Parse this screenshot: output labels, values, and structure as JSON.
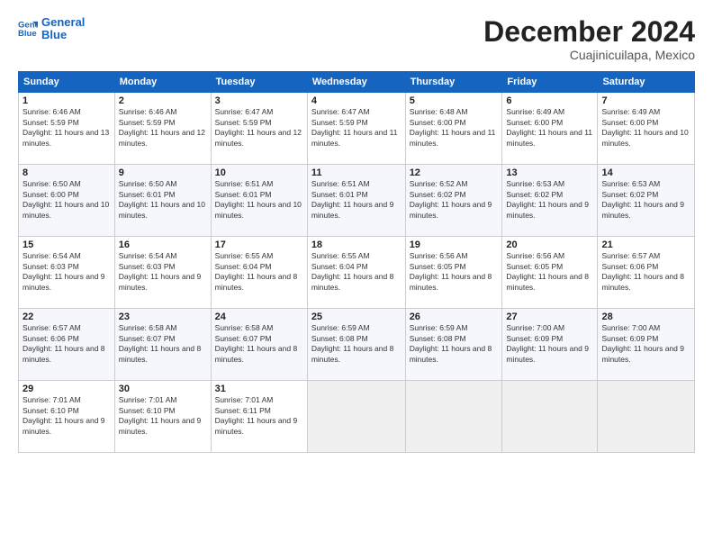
{
  "logo": {
    "line1": "General",
    "line2": "Blue"
  },
  "title": "December 2024",
  "location": "Cuajinicuilapa, Mexico",
  "weekdays": [
    "Sunday",
    "Monday",
    "Tuesday",
    "Wednesday",
    "Thursday",
    "Friday",
    "Saturday"
  ],
  "weeks": [
    [
      {
        "day": "1",
        "sunrise": "6:46 AM",
        "sunset": "5:59 PM",
        "daylight": "11 hours and 13 minutes."
      },
      {
        "day": "2",
        "sunrise": "6:46 AM",
        "sunset": "5:59 PM",
        "daylight": "11 hours and 12 minutes."
      },
      {
        "day": "3",
        "sunrise": "6:47 AM",
        "sunset": "5:59 PM",
        "daylight": "11 hours and 12 minutes."
      },
      {
        "day": "4",
        "sunrise": "6:47 AM",
        "sunset": "5:59 PM",
        "daylight": "11 hours and 11 minutes."
      },
      {
        "day": "5",
        "sunrise": "6:48 AM",
        "sunset": "6:00 PM",
        "daylight": "11 hours and 11 minutes."
      },
      {
        "day": "6",
        "sunrise": "6:49 AM",
        "sunset": "6:00 PM",
        "daylight": "11 hours and 11 minutes."
      },
      {
        "day": "7",
        "sunrise": "6:49 AM",
        "sunset": "6:00 PM",
        "daylight": "11 hours and 10 minutes."
      }
    ],
    [
      {
        "day": "8",
        "sunrise": "6:50 AM",
        "sunset": "6:00 PM",
        "daylight": "11 hours and 10 minutes."
      },
      {
        "day": "9",
        "sunrise": "6:50 AM",
        "sunset": "6:01 PM",
        "daylight": "11 hours and 10 minutes."
      },
      {
        "day": "10",
        "sunrise": "6:51 AM",
        "sunset": "6:01 PM",
        "daylight": "11 hours and 10 minutes."
      },
      {
        "day": "11",
        "sunrise": "6:51 AM",
        "sunset": "6:01 PM",
        "daylight": "11 hours and 9 minutes."
      },
      {
        "day": "12",
        "sunrise": "6:52 AM",
        "sunset": "6:02 PM",
        "daylight": "11 hours and 9 minutes."
      },
      {
        "day": "13",
        "sunrise": "6:53 AM",
        "sunset": "6:02 PM",
        "daylight": "11 hours and 9 minutes."
      },
      {
        "day": "14",
        "sunrise": "6:53 AM",
        "sunset": "6:02 PM",
        "daylight": "11 hours and 9 minutes."
      }
    ],
    [
      {
        "day": "15",
        "sunrise": "6:54 AM",
        "sunset": "6:03 PM",
        "daylight": "11 hours and 9 minutes."
      },
      {
        "day": "16",
        "sunrise": "6:54 AM",
        "sunset": "6:03 PM",
        "daylight": "11 hours and 9 minutes."
      },
      {
        "day": "17",
        "sunrise": "6:55 AM",
        "sunset": "6:04 PM",
        "daylight": "11 hours and 8 minutes."
      },
      {
        "day": "18",
        "sunrise": "6:55 AM",
        "sunset": "6:04 PM",
        "daylight": "11 hours and 8 minutes."
      },
      {
        "day": "19",
        "sunrise": "6:56 AM",
        "sunset": "6:05 PM",
        "daylight": "11 hours and 8 minutes."
      },
      {
        "day": "20",
        "sunrise": "6:56 AM",
        "sunset": "6:05 PM",
        "daylight": "11 hours and 8 minutes."
      },
      {
        "day": "21",
        "sunrise": "6:57 AM",
        "sunset": "6:06 PM",
        "daylight": "11 hours and 8 minutes."
      }
    ],
    [
      {
        "day": "22",
        "sunrise": "6:57 AM",
        "sunset": "6:06 PM",
        "daylight": "11 hours and 8 minutes."
      },
      {
        "day": "23",
        "sunrise": "6:58 AM",
        "sunset": "6:07 PM",
        "daylight": "11 hours and 8 minutes."
      },
      {
        "day": "24",
        "sunrise": "6:58 AM",
        "sunset": "6:07 PM",
        "daylight": "11 hours and 8 minutes."
      },
      {
        "day": "25",
        "sunrise": "6:59 AM",
        "sunset": "6:08 PM",
        "daylight": "11 hours and 8 minutes."
      },
      {
        "day": "26",
        "sunrise": "6:59 AM",
        "sunset": "6:08 PM",
        "daylight": "11 hours and 8 minutes."
      },
      {
        "day": "27",
        "sunrise": "7:00 AM",
        "sunset": "6:09 PM",
        "daylight": "11 hours and 9 minutes."
      },
      {
        "day": "28",
        "sunrise": "7:00 AM",
        "sunset": "6:09 PM",
        "daylight": "11 hours and 9 minutes."
      }
    ],
    [
      {
        "day": "29",
        "sunrise": "7:01 AM",
        "sunset": "6:10 PM",
        "daylight": "11 hours and 9 minutes."
      },
      {
        "day": "30",
        "sunrise": "7:01 AM",
        "sunset": "6:10 PM",
        "daylight": "11 hours and 9 minutes."
      },
      {
        "day": "31",
        "sunrise": "7:01 AM",
        "sunset": "6:11 PM",
        "daylight": "11 hours and 9 minutes."
      },
      null,
      null,
      null,
      null
    ]
  ]
}
